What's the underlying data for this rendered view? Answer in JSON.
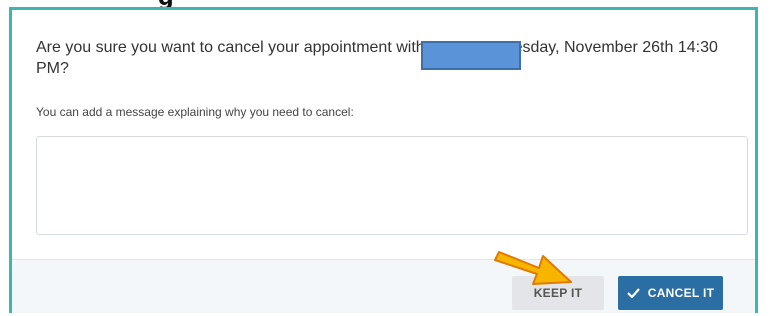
{
  "header": {
    "title_fragment": "g"
  },
  "dialog": {
    "question": "Are you sure you want to cancel your appointment with Grant on Tuesday, November 26th 14:30 PM?",
    "hint": "You can add a message explaining why you need to cancel:",
    "message_placeholder": "",
    "keep_label": "KEEP IT",
    "cancel_label": "CANCEL IT"
  },
  "colors": {
    "border": "#3fb5b3",
    "primary": "#2a6ea3",
    "secondary": "#e3e5e8",
    "annotation_arrow": "#f7b500"
  },
  "icons": [
    "check-icon",
    "arrow-annotation-icon"
  ]
}
